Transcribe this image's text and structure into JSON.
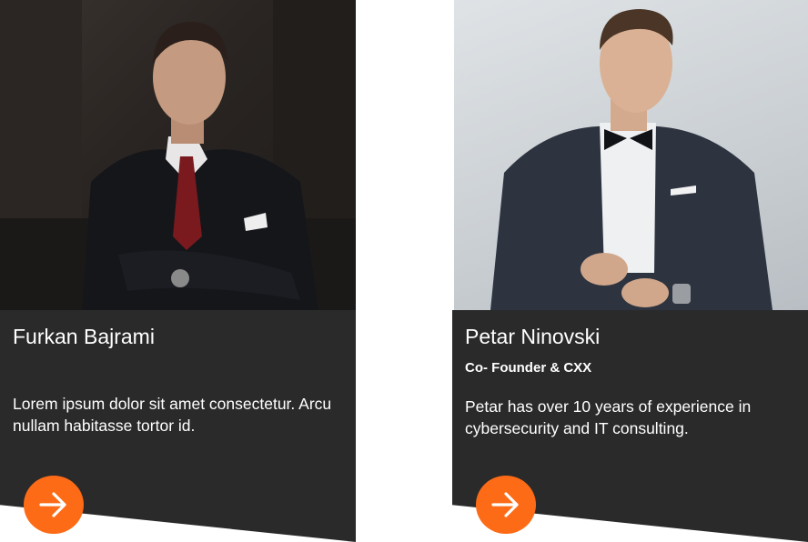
{
  "cards": [
    {
      "name": "Furkan Bajrami",
      "role": "",
      "description": "Lorem ipsum dolor sit amet consectetur. Arcu nullam habitasse tortor id.",
      "arrow_icon": "arrow-right-icon"
    },
    {
      "name": "Petar Ninovski",
      "role": "Co- Founder & CXX",
      "description": "Petar has over 10 years of experience in cybersecurity and IT consulting.",
      "arrow_icon": "arrow-right-icon"
    }
  ],
  "colors": {
    "panel": "#2a2a2b",
    "accent": "#fe6b16",
    "text": "#ffffff"
  }
}
